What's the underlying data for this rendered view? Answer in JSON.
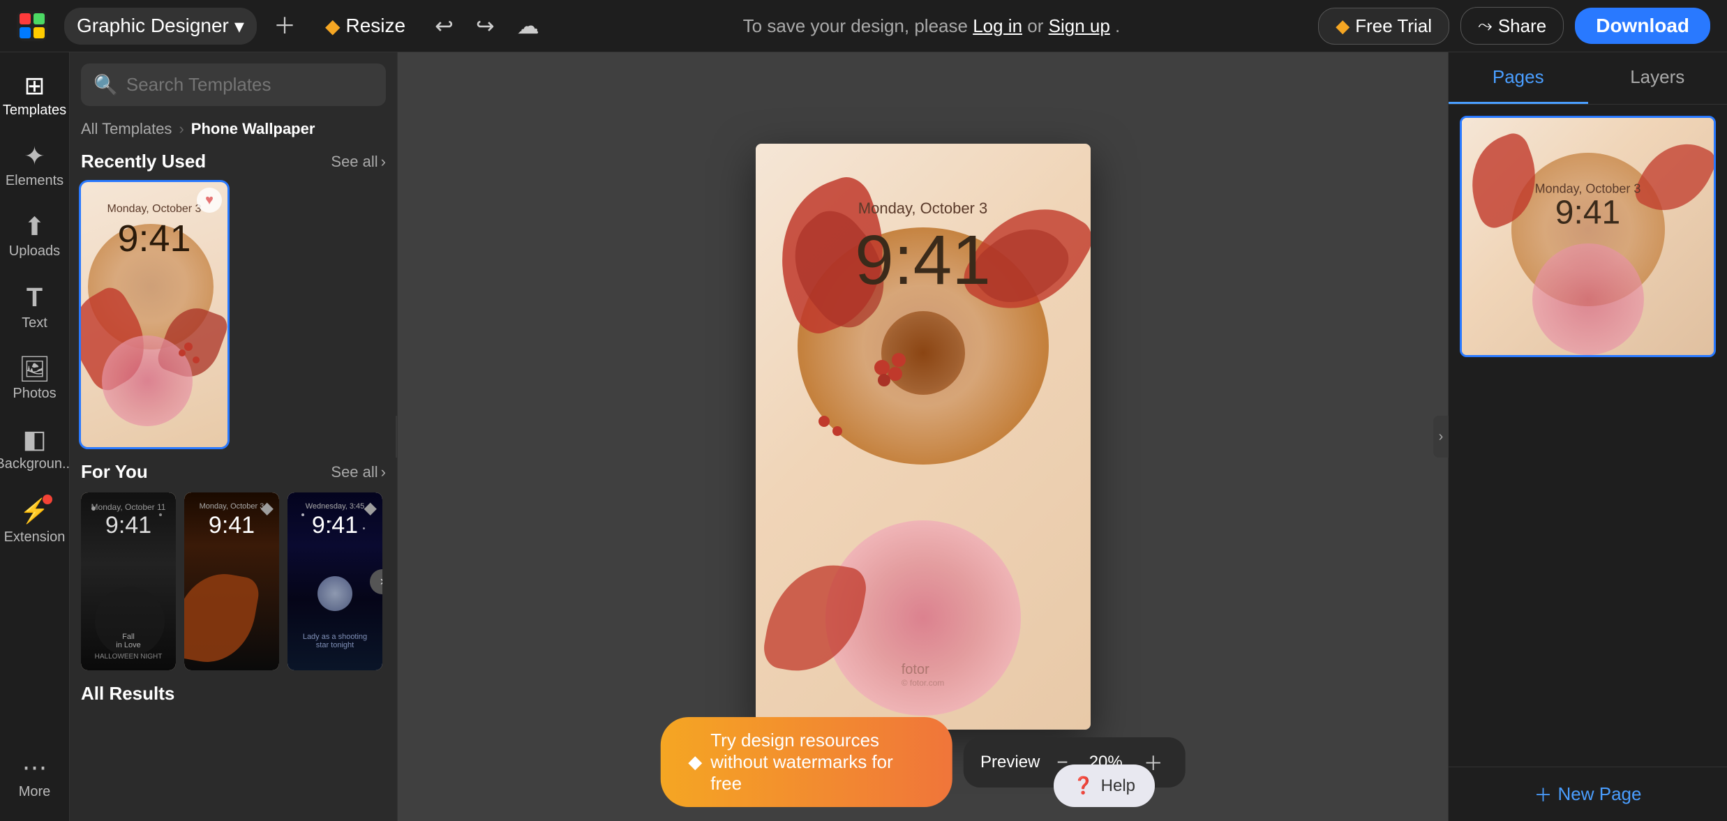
{
  "topbar": {
    "logo_alt": "Fotor",
    "designer_label": "Graphic Designer",
    "resize_label": "Resize",
    "save_msg": "To save your design, please",
    "log_in": "Log in",
    "or": "or",
    "sign_up": "Sign up",
    "period": ".",
    "free_trial_label": "Free Trial",
    "share_label": "Share",
    "download_label": "Download"
  },
  "sidebar": {
    "items": [
      {
        "id": "templates",
        "label": "Templates",
        "icon": "⊞"
      },
      {
        "id": "elements",
        "label": "Elements",
        "icon": "✦"
      },
      {
        "id": "uploads",
        "label": "Uploads",
        "icon": "↑"
      },
      {
        "id": "text",
        "label": "Text",
        "icon": "T"
      },
      {
        "id": "photos",
        "label": "Photos",
        "icon": "🖼"
      },
      {
        "id": "backgrounds",
        "label": "Backgroun...",
        "icon": "◧"
      },
      {
        "id": "extension",
        "label": "Extension",
        "icon": "⚡"
      },
      {
        "id": "more",
        "label": "More",
        "icon": "⋯"
      }
    ]
  },
  "template_panel": {
    "search_placeholder": "Search Templates",
    "breadcrumb_all": "All Templates",
    "breadcrumb_current": "Phone Wallpaper",
    "recently_used_title": "Recently Used",
    "see_all_label": "See all",
    "for_you_title": "For You",
    "all_results_title": "All Results",
    "thumb1_time": "9:41",
    "thumb1_date": "Monday, October 3",
    "thumb2_time": "9:41",
    "thumb2_date": "Monday, October 11",
    "thumb3_time": "9:41",
    "thumb3_date": "Monday, October 3",
    "thumb4_time": "9:41",
    "thumb4_date": "Wednesday, 3:45"
  },
  "canvas": {
    "date_text": "Monday, October 3",
    "time_text": "9:41",
    "watermark": "fotor"
  },
  "right_panel": {
    "pages_tab": "Pages",
    "layers_tab": "Layers",
    "page_time": "9:41",
    "page_date": "Monday, October 3",
    "new_page_label": "New Page"
  },
  "bottom": {
    "watermark_notice": "Try design resources without watermarks for free",
    "preview_label": "Preview",
    "zoom_value": "20%",
    "help_label": "Help"
  }
}
